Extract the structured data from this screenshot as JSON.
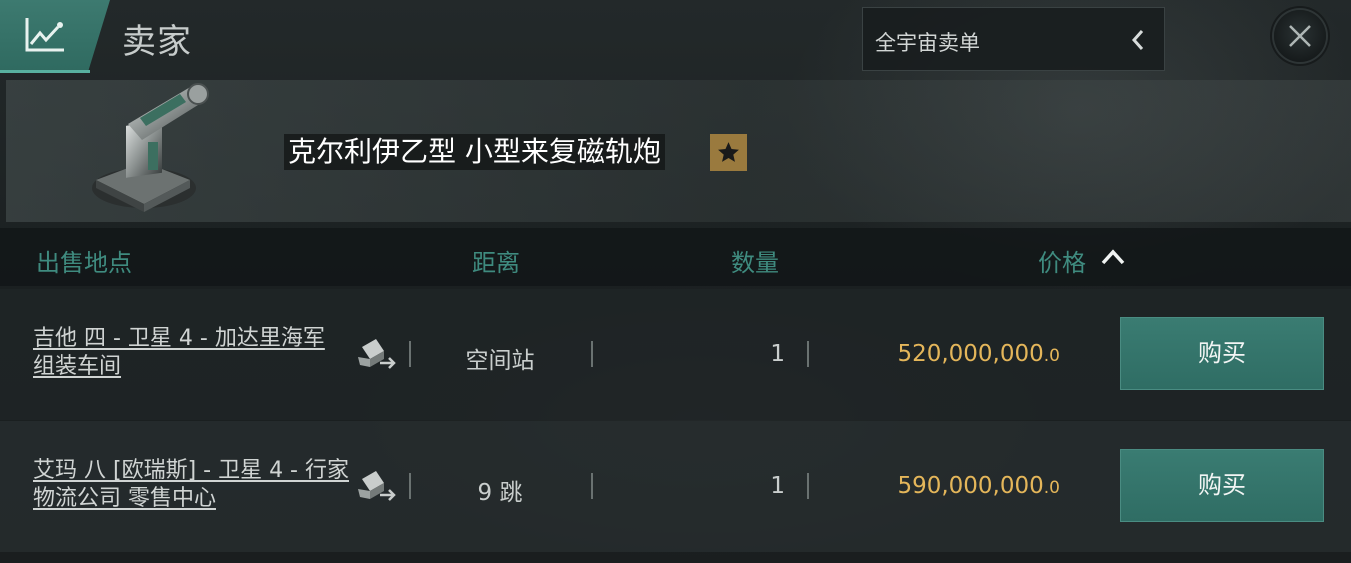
{
  "window": {
    "title": "卖家",
    "region_select": {
      "value": "全宇宙卖单",
      "icon": "chevron-left-icon"
    },
    "close_icon": "close-icon",
    "header_icon": "market-chart-icon"
  },
  "item": {
    "name": "克尔利伊乙型 小型来复磁轨炮",
    "icon": "railgun-turret-icon",
    "favorite_icon": "star-icon"
  },
  "table": {
    "columns": {
      "location": "出售地点",
      "distance": "距离",
      "quantity": "数量",
      "price": "价格"
    },
    "sort": {
      "column": "price",
      "direction": "ascending",
      "icon": "chevron-up-icon"
    },
    "rows": [
      {
        "location": "吉他 四 - 卫星 4 - 加达里海军 组装车间",
        "distance": "空间站",
        "quantity": "1",
        "price_main": "520,000,000",
        "price_decimal": ".0",
        "buy_label": "购买",
        "dock_icon": "set-destination-icon"
      },
      {
        "location": "艾玛 八 [欧瑞斯] - 卫星 4 - 行家物流公司 零售中心",
        "distance": "9 跳",
        "quantity": "1",
        "price_main": "590,000,000",
        "price_decimal": ".0",
        "buy_label": "购买",
        "dock_icon": "set-destination-icon"
      }
    ]
  },
  "colors": {
    "accent": "#3a7c72",
    "header_text": "#3f8b7f",
    "price": "#e4b65a",
    "favorite": "#9a7a3e"
  }
}
